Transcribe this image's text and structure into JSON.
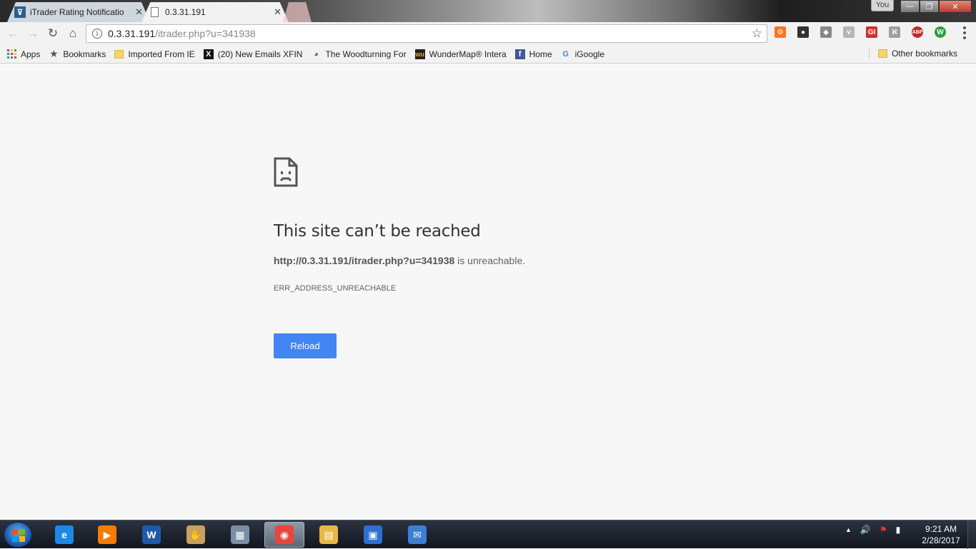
{
  "tabs": [
    {
      "label": "iTrader Rating Notificatio",
      "favicon": "itrader-favicon",
      "close": "✕"
    },
    {
      "label": "0.3.31.191",
      "favicon": "document-icon",
      "close": "✕"
    }
  ],
  "profile_label": "You",
  "window_controls": {
    "minimize": "—",
    "maximize": "❐",
    "close": "✕"
  },
  "toolbar": {
    "back": "←",
    "forward": "→",
    "reload": "↻",
    "home": "⌂",
    "url_host": "0.3.31.191",
    "url_path": "/itrader.php?u=341938",
    "star": "☆"
  },
  "extensions": [
    {
      "name": "hubspot-ext-icon",
      "glyph": "⚙",
      "color": "#f57722"
    },
    {
      "name": "mask-ext-icon",
      "glyph": "●",
      "color": "#333333"
    },
    {
      "name": "pocket-ext-icon",
      "glyph": "◆",
      "color": "#888888"
    },
    {
      "name": "v-ext-icon",
      "glyph": "v",
      "color": "#b5b5b5"
    },
    {
      "name": "gi-ext-icon",
      "glyph": "GI",
      "color": "#d32f2f"
    },
    {
      "name": "grammar-ext-icon",
      "glyph": "ℵ",
      "color": "#9e9e9e"
    },
    {
      "name": "adblock-plus-icon",
      "glyph": "ABP",
      "color": "#c62828"
    },
    {
      "name": "w-ext-icon",
      "glyph": "W",
      "color": "#2e9e3e"
    }
  ],
  "bookmarks": [
    {
      "label": "Apps",
      "icon": "apps-grid-icon"
    },
    {
      "label": "Bookmarks",
      "icon": "star-icon",
      "glyph": "★"
    },
    {
      "label": "Imported From IE",
      "icon": "folder-icon"
    },
    {
      "label": "(20) New Emails  XFIN",
      "icon": "x-icon",
      "glyph": "X"
    },
    {
      "label": "The Woodturning For",
      "icon": "woodturning-icon",
      "glyph": "◕"
    },
    {
      "label": "WunderMap® Intera",
      "icon": "wunderground-icon",
      "glyph": "wu"
    },
    {
      "label": "Home",
      "icon": "facebook-icon",
      "glyph": "f"
    },
    {
      "label": "iGoogle",
      "icon": "google-icon",
      "glyph": "G"
    }
  ],
  "other_bookmarks": "Other bookmarks",
  "error": {
    "title": "This site can’t be reached",
    "url_bold": "http://0.3.31.191/itrader.php?u=341938",
    "desc_suffix": " is unreachable.",
    "code": "ERR_ADDRESS_UNREACHABLE",
    "reload_label": "Reload"
  },
  "taskbar": {
    "apps": [
      {
        "name": "ie-taskbar-icon",
        "glyph": "e",
        "color": "#1e88e5",
        "active": false
      },
      {
        "name": "media-player-taskbar-icon",
        "glyph": "▶",
        "color": "#f57c00",
        "active": false
      },
      {
        "name": "word-taskbar-icon",
        "glyph": "W",
        "color": "#1e5aa8",
        "active": false
      },
      {
        "name": "handshake-taskbar-icon",
        "glyph": "✋",
        "color": "#c8a060",
        "active": false
      },
      {
        "name": "calculator-taskbar-icon",
        "glyph": "▦",
        "color": "#7a8fa3",
        "active": false
      },
      {
        "name": "chrome-taskbar-icon",
        "glyph": "◉",
        "color": "#e8453c",
        "active": true
      },
      {
        "name": "explorer-taskbar-icon",
        "glyph": "▤",
        "color": "#e6b84a",
        "active": false
      },
      {
        "name": "remote-desktop-taskbar-icon",
        "glyph": "▣",
        "color": "#2f6fd0",
        "active": false
      },
      {
        "name": "thunderbird-taskbar-icon",
        "glyph": "✉",
        "color": "#3d7fd3",
        "active": false
      }
    ],
    "tray": {
      "arrow": "▲",
      "volume": "🔊",
      "network": "▮",
      "flag": "⚑"
    },
    "time": "9:21 AM",
    "date": "2/28/2017"
  }
}
